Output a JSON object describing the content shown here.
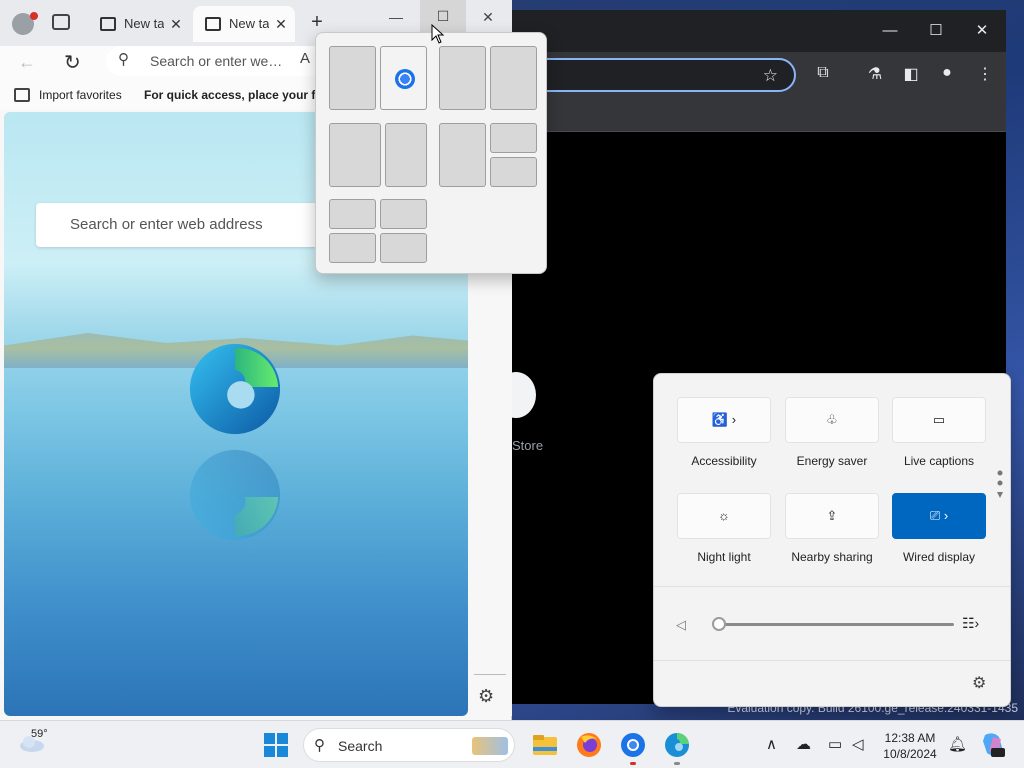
{
  "edge": {
    "tabs": [
      {
        "label": "New tab"
      },
      {
        "label": "New tab"
      }
    ],
    "address_placeholder": "Search or enter web address",
    "favorites_bar": {
      "import_label": "Import favorites",
      "quick_access_text": "For quick access, place your favorites here"
    },
    "ntp_search_placeholder": "Search or enter web address"
  },
  "chrome": {
    "store_label": "Store"
  },
  "quick_settings": {
    "tiles": [
      {
        "label": "Accessibility",
        "icon": "accessibility-icon",
        "active": false,
        "has_chevron": true
      },
      {
        "label": "Energy saver",
        "icon": "energy-saver-icon",
        "active": false,
        "has_chevron": false
      },
      {
        "label": "Live captions",
        "icon": "live-captions-icon",
        "active": false,
        "has_chevron": false
      },
      {
        "label": "Night light",
        "icon": "night-light-icon",
        "active": false,
        "has_chevron": false
      },
      {
        "label": "Nearby sharing",
        "icon": "nearby-sharing-icon",
        "active": false,
        "has_chevron": false
      },
      {
        "label": "Wired display",
        "icon": "cast-icon",
        "active": true,
        "has_chevron": true
      }
    ],
    "volume_level": 0,
    "accent_color": "#0067c0"
  },
  "desktop": {
    "watermark": "Evaluation copy. Build 26100.ge_release.240331-1435"
  },
  "taskbar": {
    "weather_temp": "59°",
    "search_label": "Search",
    "clock_time": "12:38 AM",
    "clock_date": "10/8/2024"
  }
}
